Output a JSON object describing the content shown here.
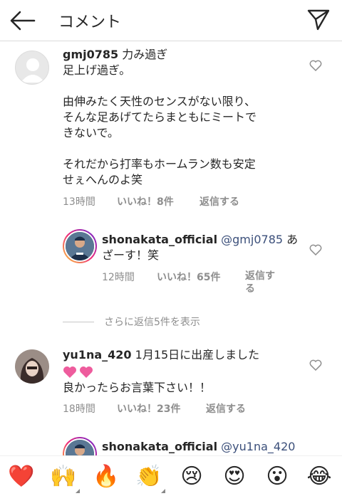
{
  "header": {
    "title": "コメント"
  },
  "comments": [
    {
      "username": "gmj0785",
      "line1": " 力み過ぎ",
      "body": "足上げ過ぎ。\n\n由伸みたく天性のセンスがない限り、\nそんな足あげてたらまともにミートで\nきないで。\n\nそれだから打率もホームラン数も安定\nせぇへんのよ笑",
      "time": "13時間",
      "likes": "いいね！8件",
      "reply": "返信する"
    },
    {
      "username": "shonakata_official",
      "mention": " @gmj0785",
      "text_tail": " あ",
      "line2": "ざーす！笑",
      "time": "12時間",
      "likes": "いいね！65件",
      "reply_1": "返信す",
      "reply_2": "る"
    },
    {
      "username": "yu1na_420",
      "line1": " 1月15日に出産しました",
      "line3": "良かったらお言葉下さい！！",
      "time": "18時間",
      "likes": "いいね！23件",
      "reply": "返信する"
    },
    {
      "username": "shonakata_official",
      "mention": " @yu1na_420"
    }
  ],
  "more_replies": "さらに返信5件を表示",
  "emoji_bar": [
    "❤️",
    "🙌",
    "🔥",
    "👏",
    "😢",
    "😍",
    "😮",
    "😂"
  ],
  "colors": {
    "accent": "#ed4956",
    "muted": "#8e8e8e"
  }
}
